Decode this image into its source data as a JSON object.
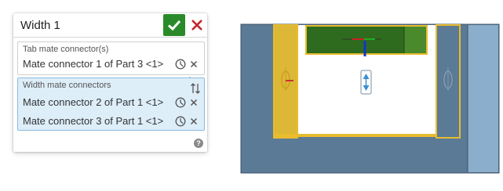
{
  "dialog": {
    "title": "Width 1",
    "tab_field": {
      "label": "Tab mate connector(s)",
      "entries": [
        "Mate connector 1 of Part 3 <1>"
      ]
    },
    "width_field": {
      "label": "Width mate connectors",
      "entries": [
        "Mate connector 2 of Part 1 <1>",
        "Mate connector 3 of Part 1 <1>"
      ]
    },
    "help": "?"
  },
  "colors": {
    "confirm": "#2a8a2a",
    "cancel": "#c8242b",
    "selected_field_bg": "#ddeef9",
    "part_gray_blue": "#5b7a96",
    "highlight_yellow": "#e8bc2e",
    "highlight_green": "#2f6b1e"
  },
  "icons": [
    "checkmark-icon",
    "close-icon",
    "clock-icon",
    "remove-icon",
    "sort-icon",
    "mouse-pointer-icon",
    "help-icon"
  ]
}
